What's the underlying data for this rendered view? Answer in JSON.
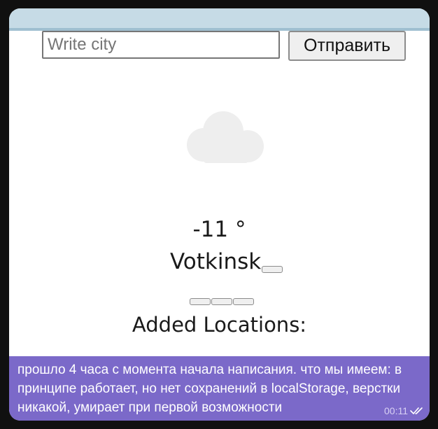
{
  "form": {
    "city_placeholder": "Write city",
    "city_value": "",
    "submit_label": "Отправить"
  },
  "weather": {
    "icon": "cloud-icon",
    "temperature": "-11 °",
    "city": "Votkinsk"
  },
  "locations": {
    "title": "Added Locations:"
  },
  "message": {
    "text": "прошло 4 часа с момента начала написания. что мы имеем: в принципе работает, но нет сохранений в localStorage, верстки никакой, умирает при первой возможности",
    "time": "00:11",
    "status_icon": "double-check-icon"
  },
  "colors": {
    "top_bar": "#c6dbe6",
    "caption_bg": "#7b69c9",
    "page_bg": "#101010"
  }
}
